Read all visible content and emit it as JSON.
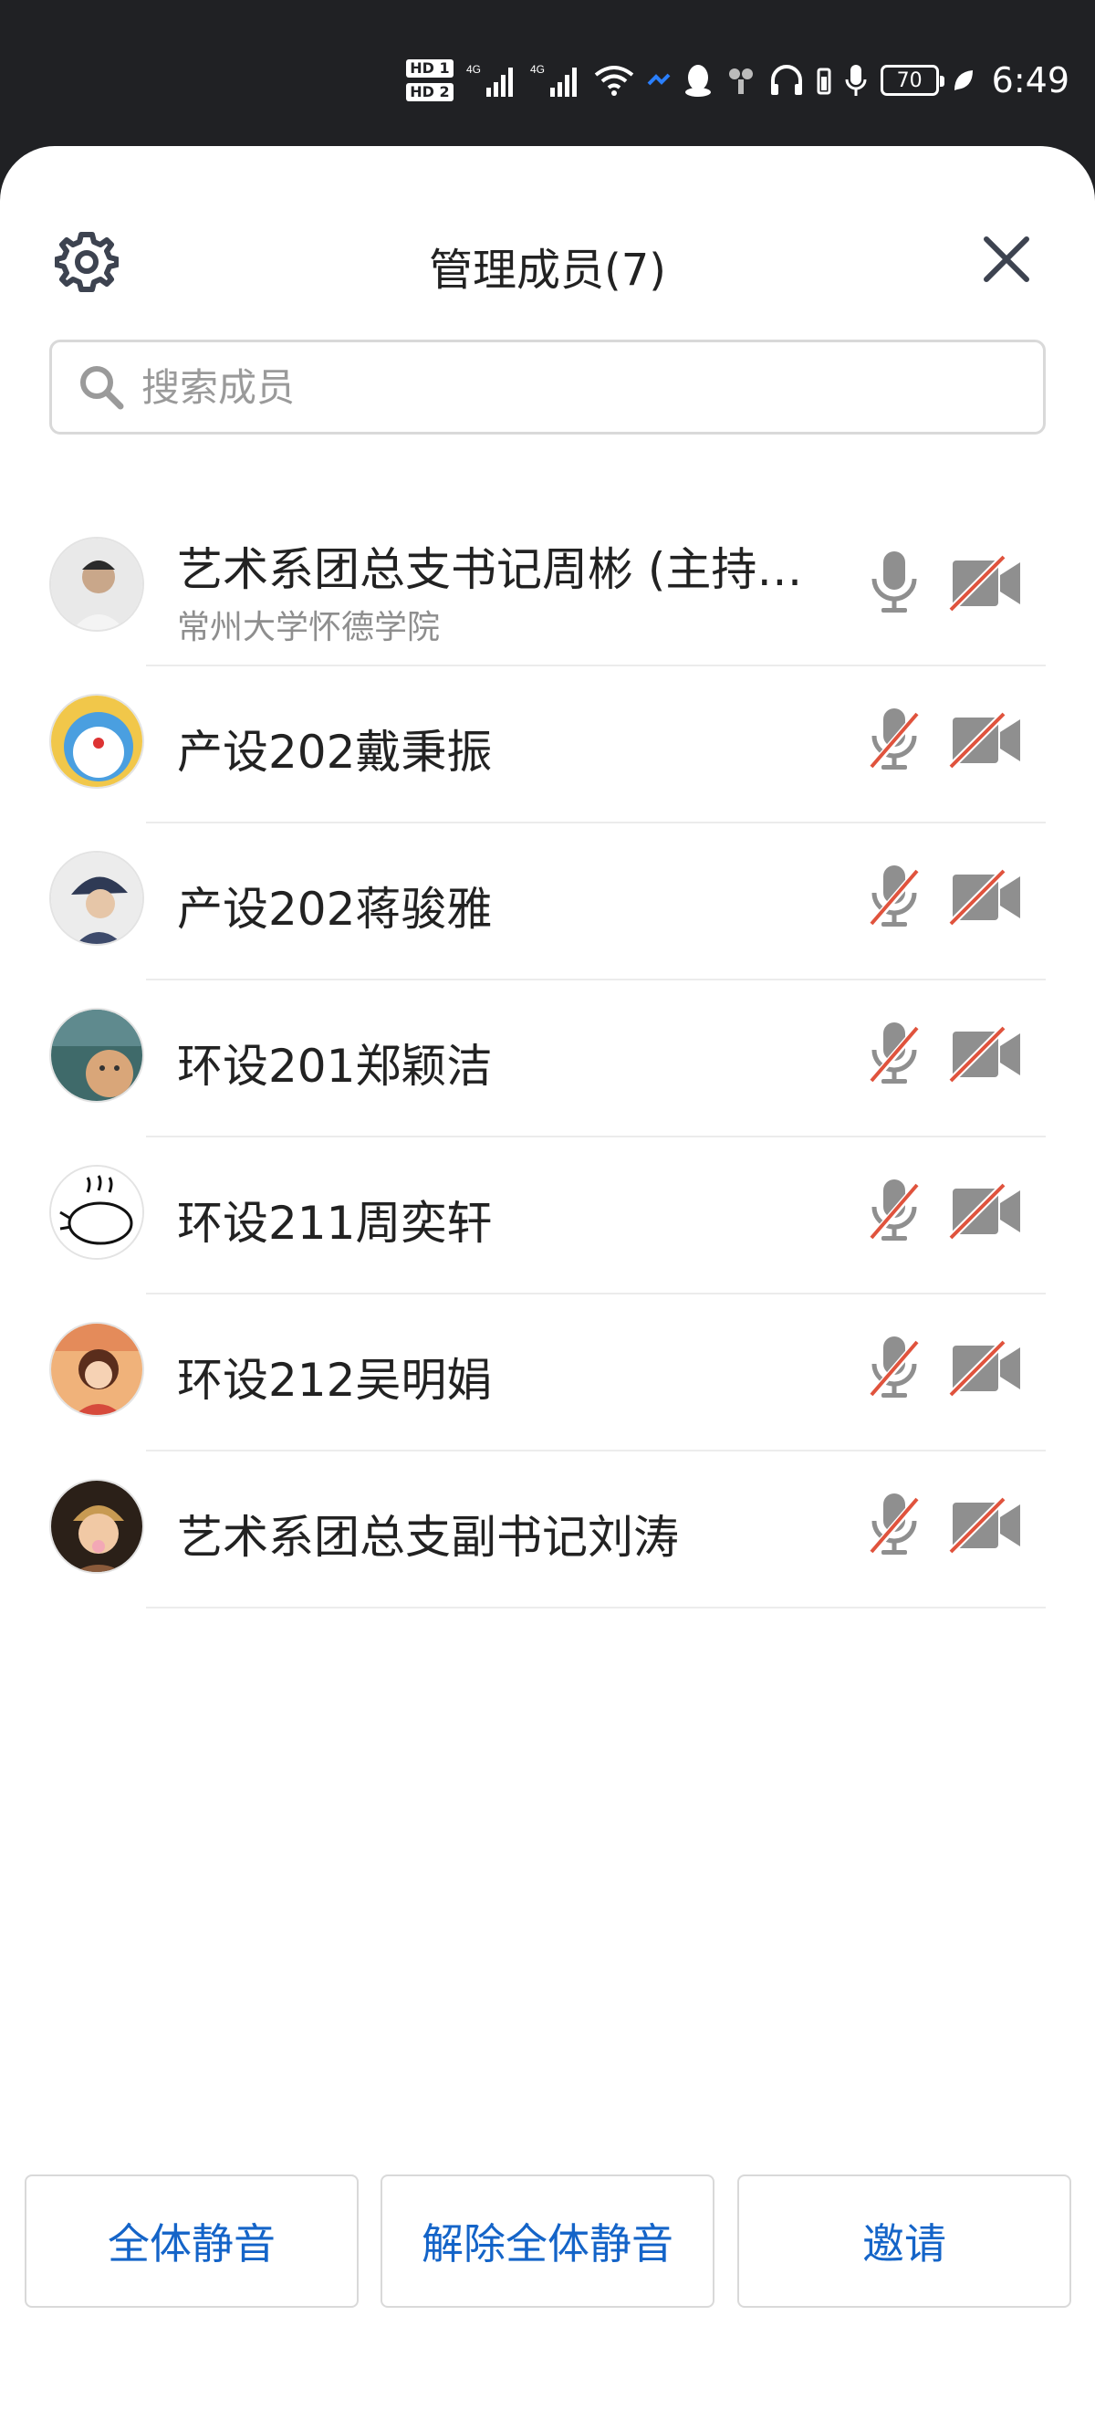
{
  "status_bar": {
    "time": "6:49",
    "battery": "70",
    "network1": "4G",
    "network2": "4G",
    "hd1": "HD 1",
    "hd2": "HD 2"
  },
  "header": {
    "title": "管理成员(7)",
    "settings_icon": "gear-icon",
    "close_icon": "close-icon"
  },
  "search": {
    "placeholder": "搜索成员",
    "value": ""
  },
  "members": [
    {
      "name": "艺术系团总支书记周彬 (主持…",
      "subtitle": "常州大学怀德学院",
      "mic": "on",
      "camera": "off"
    },
    {
      "name": "产设202戴秉振",
      "mic": "off",
      "camera": "off"
    },
    {
      "name": "产设202蒋骏雅",
      "mic": "off",
      "camera": "off"
    },
    {
      "name": "环设201郑颖洁",
      "mic": "off",
      "camera": "off"
    },
    {
      "name": "环设211周奕轩",
      "mic": "off",
      "camera": "off"
    },
    {
      "name": "环设212吴明娟",
      "mic": "off",
      "camera": "off"
    },
    {
      "name": "艺术系团总支副书记刘涛",
      "mic": "off",
      "camera": "off"
    }
  ],
  "footer": {
    "mute_all": "全体静音",
    "unmute_all": "解除全体静音",
    "invite": "邀请"
  },
  "colors": {
    "accent": "#1464c8",
    "status_bar": "#202124",
    "icon_gray": "#8f8f8f",
    "strike_red": "#e0533d"
  }
}
